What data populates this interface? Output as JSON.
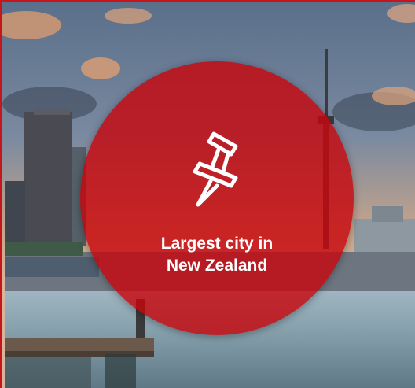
{
  "badge": {
    "caption_line1": "Largest city in",
    "caption_line2": "New Zealand",
    "icon": "pushpin-icon",
    "color": "#c8040a"
  },
  "background": {
    "description_icon": "city-waterfront-photo",
    "accent_border_color": "#c4161c"
  }
}
